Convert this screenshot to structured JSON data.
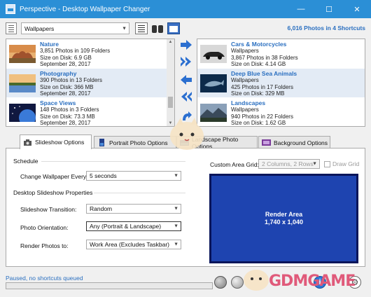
{
  "window": {
    "title": "Perspective - Desktop Wallpaper Changer",
    "controls": {
      "minimize": "—",
      "maximize": "☐",
      "close": "✕"
    }
  },
  "toolbar": {
    "selected_shortcut": "Wallpapers",
    "photo_summary": "6,016 Photos in 4 Shortcuts"
  },
  "source_list": {
    "items": [
      {
        "name": "Nature",
        "photos": "3,851 Photos in 109 Folders",
        "size": "Size on Disk: 6.9 GB",
        "date": "September 28, 2017"
      },
      {
        "name": "Photography",
        "photos": "390 Photos in 13 Folders",
        "size": "Size on Disk: 366 MB",
        "date": "September 28, 2017"
      },
      {
        "name": "Space Views",
        "photos": "148 Photos in 3 Folders",
        "size": "Size on Disk: 73.3 MB",
        "date": "September 28, 2017"
      }
    ]
  },
  "queue_list": {
    "items": [
      {
        "name": "Cars & Motorcycles",
        "group": "Wallpapers",
        "photos": "3,867 Photos in 38 Folders",
        "size": "Size on Disk: 4.14 GB"
      },
      {
        "name": "Deep Blue Sea Animals",
        "group": "Wallpapers",
        "photos": "425 Photos in 17 Folders",
        "size": "Size on Disk: 329 MB"
      },
      {
        "name": "Landscapes",
        "group": "Wallpapers",
        "photos": "940 Photos in 22 Folders",
        "size": "Size on Disk: 1.62 GB"
      }
    ]
  },
  "tabs": [
    {
      "label": "Slideshow Options",
      "active": true
    },
    {
      "label": "Portrait Photo Options",
      "active": false
    },
    {
      "label": "Landscape Photo Options",
      "active": false
    },
    {
      "label": "Background Options",
      "active": false
    }
  ],
  "slideshow": {
    "schedule_heading": "Schedule",
    "change_label": "Change Wallpaper Every:",
    "change_value": "5 seconds",
    "properties_heading": "Desktop Slideshow Properties",
    "transition_label": "Slideshow Transition:",
    "transition_value": "Random",
    "orientation_label": "Photo Orientation:",
    "orientation_value": "Any (Portrait & Landscape)",
    "render_label": "Render Photos to:",
    "render_value": "Work Area (Excludes Taskbar)"
  },
  "custom_grid": {
    "label": "Custom Area Grid:",
    "value": "2 Columns, 2 Rows",
    "draw_grid_label": "Draw Grid"
  },
  "render_area": {
    "title": "Render Area",
    "dimensions": "1,740 x 1,040"
  },
  "status": {
    "text": "Paused, no shortcuts queued",
    "progress": 0
  },
  "watermark": "GDMGAME",
  "colors": {
    "titlebar": "#2b8fd6",
    "link_blue": "#2a6fc0",
    "render_area": "#1e44b0",
    "selection": "#e3ebf5"
  }
}
